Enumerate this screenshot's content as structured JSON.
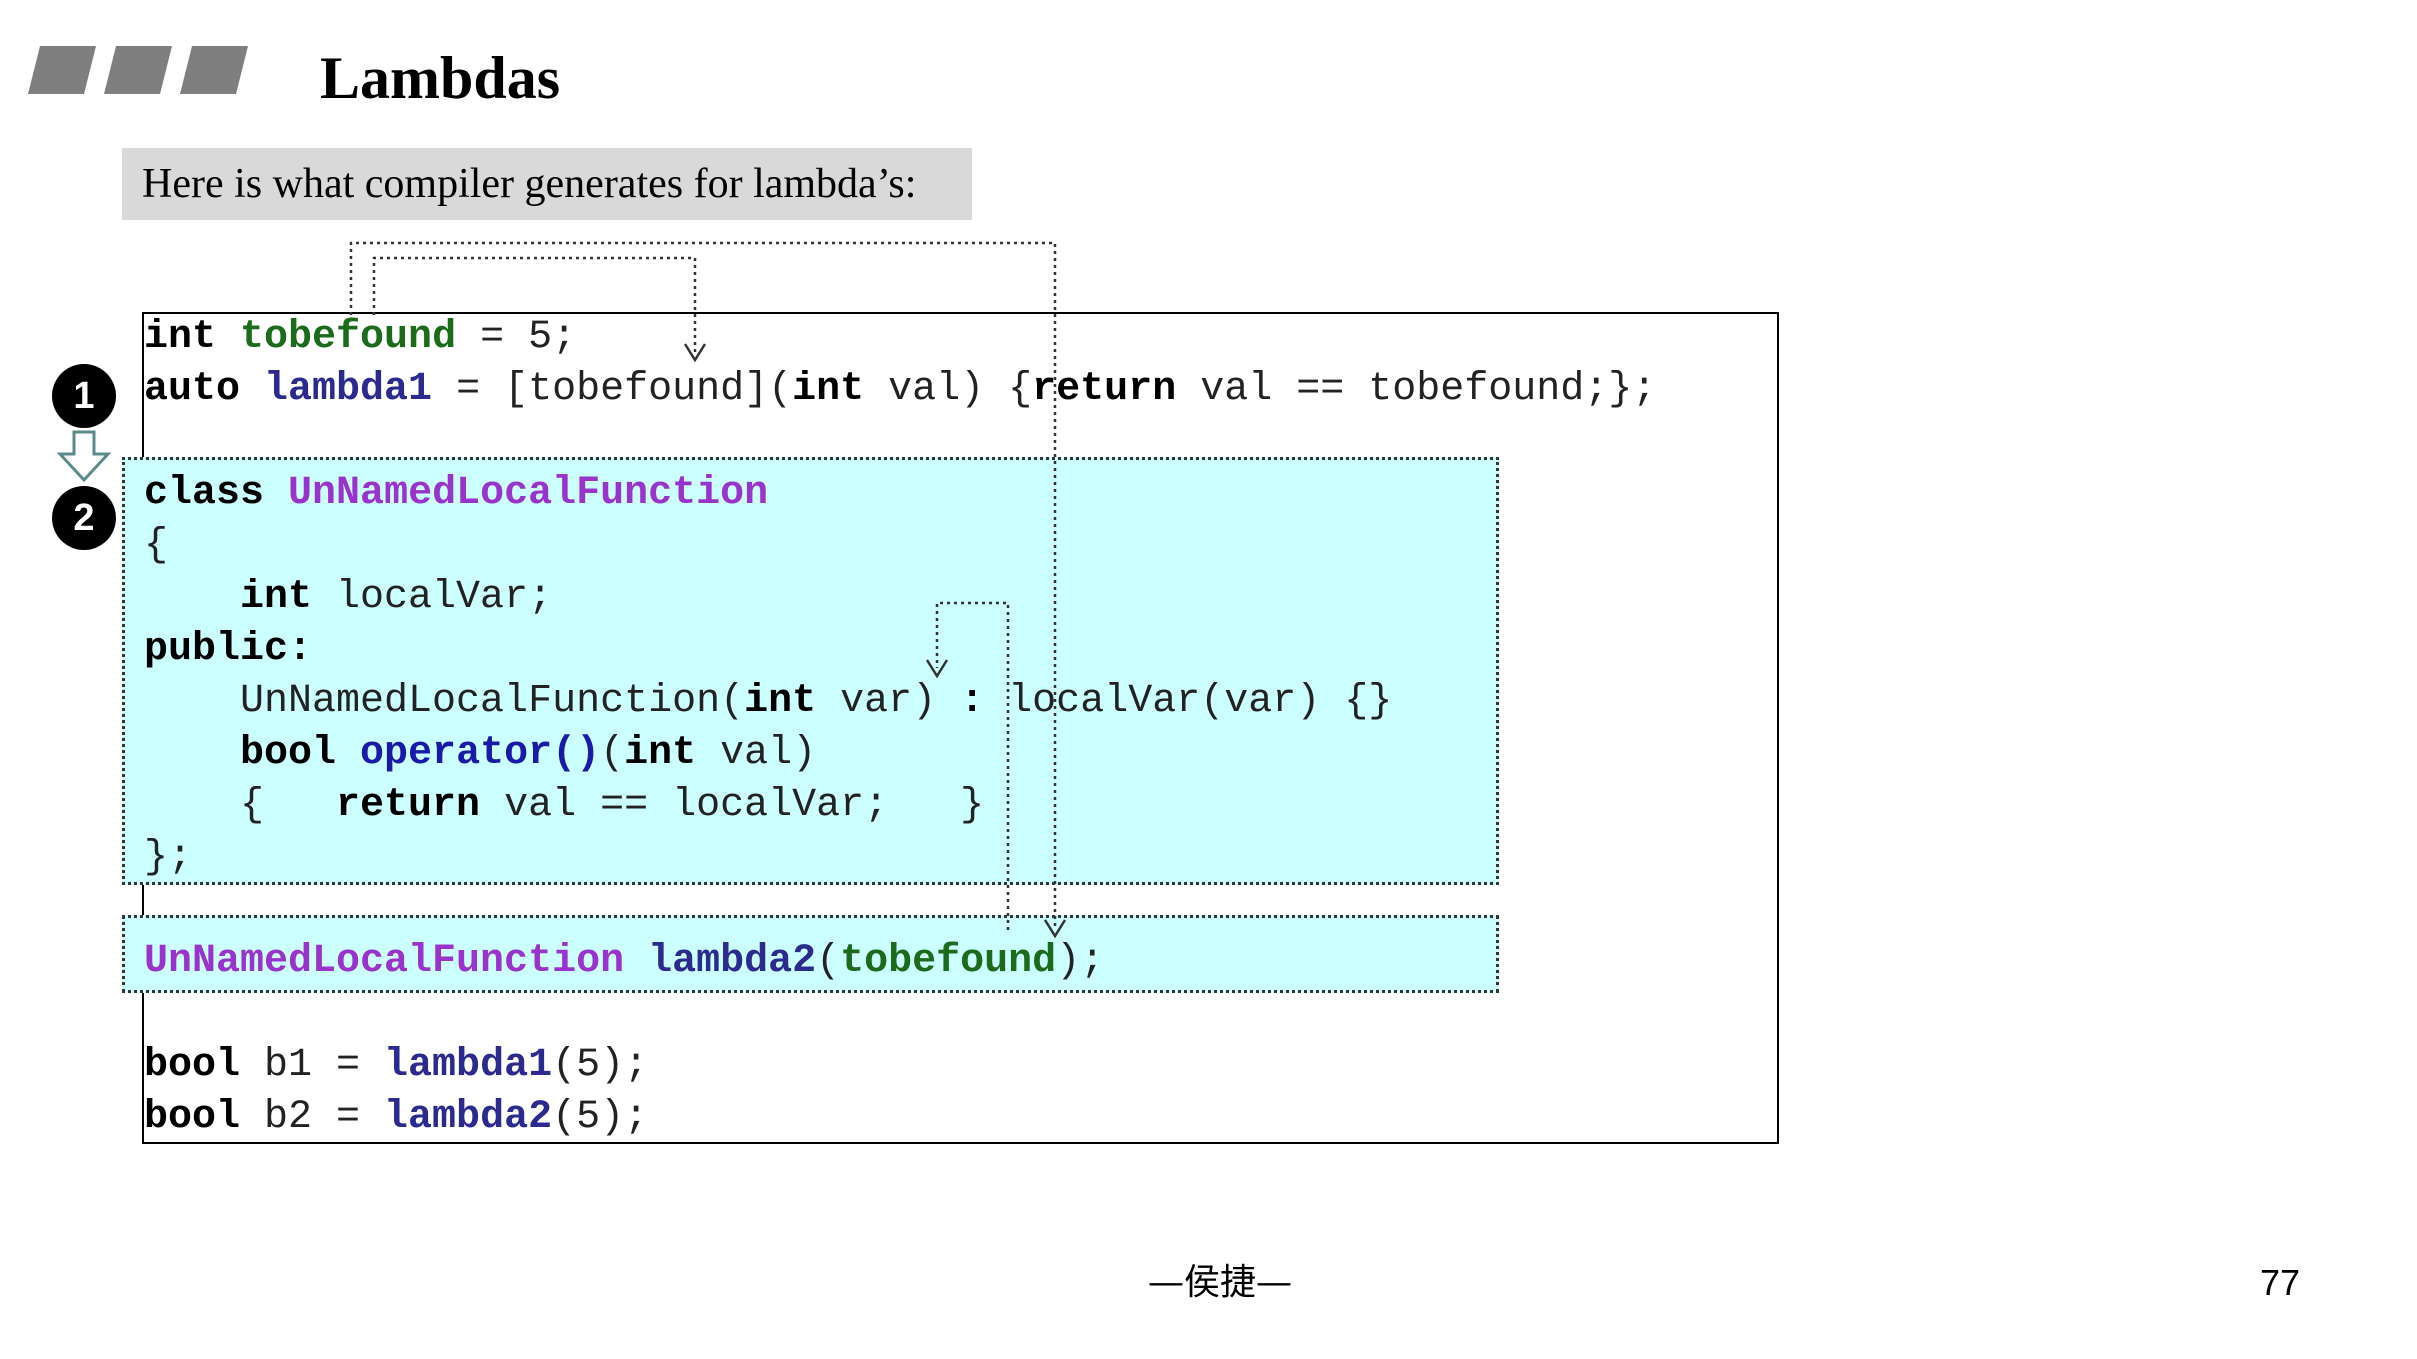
{
  "slide": {
    "title": "Lambdas",
    "banner": "Here is what compiler generates for lambda’s:",
    "footer": "—侯捷—",
    "page_number": "77"
  },
  "markers": {
    "badge1": "1",
    "badge2": "2"
  },
  "code": {
    "l1": {
      "a": "int",
      "b": " ",
      "c": "tobefound",
      "d": " = 5;"
    },
    "l2": {
      "a": "auto",
      "b": " ",
      "c": "lambda1",
      "d": " = [tobefound](",
      "e": "int",
      "f": " val) {",
      "g": "return",
      "h": " val == tobefound;};"
    },
    "l3": {
      "a": "class",
      "b": " ",
      "c": "UnNamedLocalFunction"
    },
    "l4": {
      "a": "{"
    },
    "l5": {
      "a": "    ",
      "b": "int",
      "c": " localVar;"
    },
    "l6": {
      "a": "public:"
    },
    "l7": {
      "a": "    UnNamedLocalFunction(",
      "b": "int",
      "c": " var) ",
      "d": ":",
      "e": " localVar(var) {}"
    },
    "l8": {
      "a": "    ",
      "b": "bool",
      "c": " ",
      "d": "operator()",
      "e": "(",
      "f": "int",
      "g": " val)"
    },
    "l9": {
      "a": "    {   ",
      "b": "return",
      "c": " val == localVar;   }"
    },
    "l10": {
      "a": "};"
    },
    "l11": {
      "a": "UnNamedLocalFunction",
      "b": " ",
      "c": "lambda2",
      "d": "(",
      "e": "tobefound",
      "f": ");"
    },
    "l12": {
      "a": "bool",
      "b": " b1 = ",
      "c": "lambda1",
      "d": "(5);"
    },
    "l13": {
      "a": "bool",
      "b": " b2 = ",
      "c": "lambda2",
      "d": "(5);"
    }
  },
  "colors": {
    "banner_bg": "#d9d9d9",
    "highlight_bg": "#ccffff",
    "variable_green": "#1a6b1a",
    "class_purple": "#9933cc",
    "lambda_navy": "#2b2b8f",
    "operator_blue": "#1a1aaa",
    "header_bar_gray": "#7f7f7f"
  }
}
